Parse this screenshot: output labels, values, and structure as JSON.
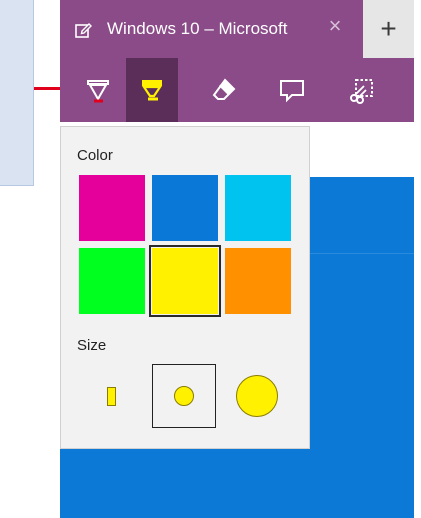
{
  "browser": {
    "tab_title": "Windows 10 – Microsoft",
    "close_glyph": "×",
    "new_tab_glyph": "+"
  },
  "toolbar": {
    "tools": [
      {
        "name": "ballpoint-pen-icon",
        "active": false
      },
      {
        "name": "highlighter-icon",
        "active": true
      },
      {
        "name": "eraser-icon",
        "active": false
      },
      {
        "name": "add-note-icon",
        "active": false
      },
      {
        "name": "clip-icon",
        "active": false
      }
    ]
  },
  "highlighter_panel": {
    "color_label": "Color",
    "size_label": "Size",
    "colors": [
      "#e5009b",
      "#0a78d7",
      "#00c3f0",
      "#00ff1e",
      "#fff100",
      "#ff9000"
    ],
    "selected_color": "#fff100",
    "sizes": [
      "small",
      "medium",
      "large"
    ],
    "selected_size": "medium"
  },
  "colors": {
    "accent_purple": "#8a4b88",
    "active_tool_bg": "#5b2d59",
    "callout_red": "#e0001b",
    "page_blue": "#0c79d6"
  }
}
